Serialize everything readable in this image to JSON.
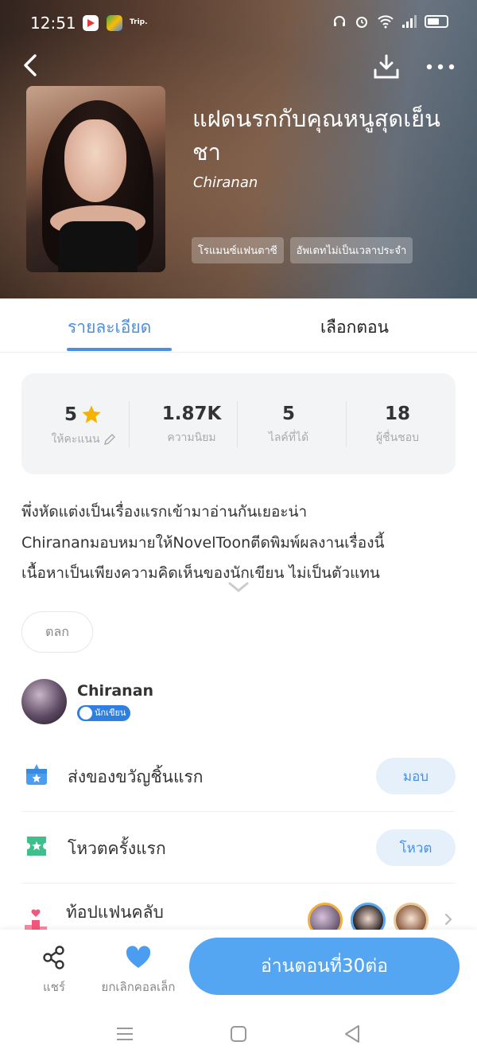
{
  "status_bar": {
    "time": "12:51",
    "app_label": "Trip."
  },
  "book": {
    "title": "แฝดนรกกับคุณหนูสุดเย็นชา",
    "author": "Chiranan",
    "tags": [
      "โรแมนซ์แฟนตาซี",
      "อัพเดทไม่เป็นเวลาประจำ"
    ]
  },
  "tabs": {
    "detail": "รายละเอียด",
    "episodes": "เลือกตอน"
  },
  "stats": [
    {
      "value": "5",
      "label": "ให้คะแนน"
    },
    {
      "value": "1.87K",
      "label": "ความนิยม"
    },
    {
      "value": "5",
      "label": "ไลค์ที่ได้"
    },
    {
      "value": "18",
      "label": "ผู้ชื่นชอบ"
    }
  ],
  "description": {
    "lines": [
      "พึ่งหัดแต่งเป็นเรื่องแรกเข้ามาอ่านกันเยอะน่า",
      "Chirananมอบหมายให้NovelToonตีดพิมพ์ผลงานเรื่องนี้",
      "เนื้อหาเป็นเพียงความคิดเห็นของนักเขียน ไม่เป็นตัวแทน"
    ]
  },
  "genre_chip": "ตลก",
  "author_section": {
    "name": "Chiranan",
    "badge": "นักเขียน"
  },
  "actions": {
    "gift_label": "ส่งของขวัญชิ้นแรก",
    "gift_button": "มอบ",
    "vote_label": "โหวตครั้งแรก",
    "vote_button": "โหวต",
    "fanclub_label": "ท้อปแฟนคลับ"
  },
  "bottom_bar": {
    "share": "แชร์",
    "unfavorite": "ยกเลิกคอลเล็ก",
    "read_button": "อ่านตอนที่30ต่อ"
  },
  "colors": {
    "accent": "#4a90e2",
    "read_button": "#55a6f2",
    "star": "#f5b301"
  }
}
